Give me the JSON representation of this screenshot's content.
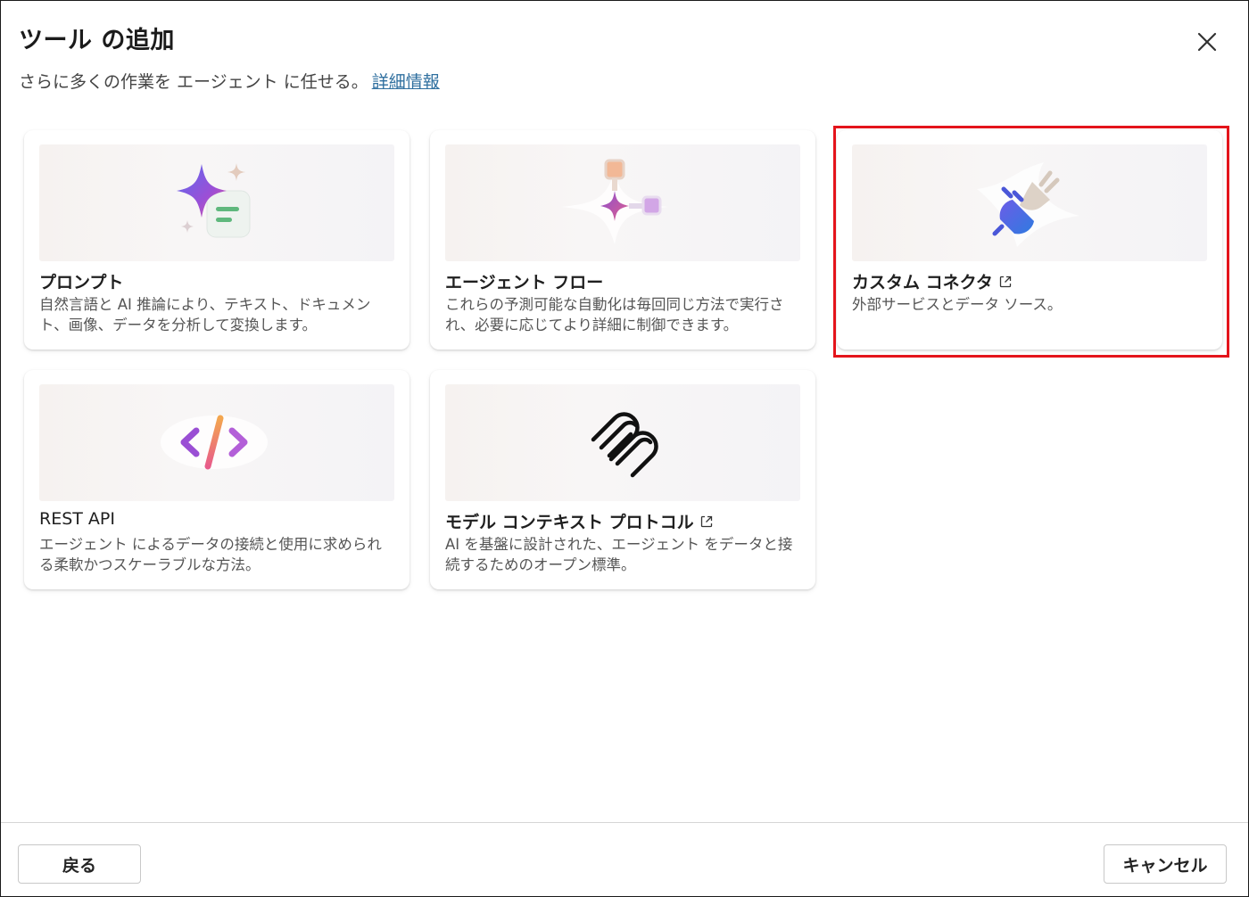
{
  "dialog": {
    "title": "ツール の追加",
    "subtitle": "さらに多くの作業を エージェント に任せる。",
    "learn_more": "詳細情報"
  },
  "cards": [
    {
      "title": "プロンプト",
      "description": "自然言語と AI 推論により、テキスト、ドキュメント、画像、データを分析して変換します。",
      "icon": "sparkle-prompt-icon"
    },
    {
      "title": "エージェント フロー",
      "description": "これらの予測可能な自動化は毎回同じ方法で実行され、必要に応じてより詳細に制御できます。",
      "icon": "agent-flow-icon"
    },
    {
      "title": "カスタム コネクタ",
      "description": "外部サービスとデータ ソース。",
      "icon": "plug-connector-icon",
      "external": true
    },
    {
      "title": "REST API",
      "description": "エージェント によるデータの接続と使用に求められる柔軟かつスケーラブルな方法。",
      "icon": "code-brackets-icon"
    },
    {
      "title": "モデル コンテキスト プロトコル",
      "description": "AI を基盤に設計された、エージェント をデータと接続するためのオープン標準。",
      "icon": "mcp-icon",
      "external": true
    }
  ],
  "footer": {
    "back_label": "戻る",
    "cancel_label": "キャンセル"
  },
  "colors": {
    "highlight": "#e4141b",
    "link": "#2f6f9f"
  }
}
